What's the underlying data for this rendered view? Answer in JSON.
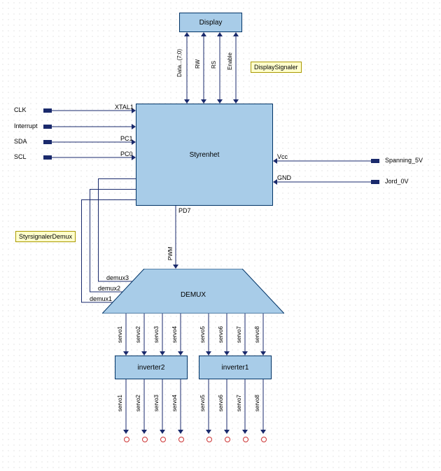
{
  "blocks": {
    "display": "Display",
    "styrenhet": "Styrenhet",
    "demux": "DEMUX",
    "inverter1": "inverter1",
    "inverter2": "inverter2"
  },
  "notes": {
    "displaySignaler": "DisplaySignaler",
    "styrsignalerDemux": "StyrsignalerDemux"
  },
  "ports": {
    "display": {
      "data": "Data...(7;0)",
      "rw": "RW",
      "rs": "RS",
      "enable": "Enable"
    },
    "styrenhet": {
      "xtal1": "XTAL1",
      "pc1": "PC1",
      "pc0": "PC0",
      "vcc": "Vcc",
      "gnd": "GND",
      "pd7": "PD7",
      "pwm": "PWM"
    },
    "demux": {
      "d1": "demux1",
      "d2": "demux2",
      "d3": "demux3"
    },
    "servo": {
      "s1": "servo1",
      "s2": "servo2",
      "s3": "servo3",
      "s4": "servo4",
      "s5": "servo5",
      "s6": "servo6",
      "s7": "servo7",
      "s8": "servo8"
    }
  },
  "external": {
    "clk": "CLK",
    "interrupt": "Interrupt",
    "sda": "SDA",
    "scl": "SCL",
    "spanning": "Spanning_5V",
    "jord": "Jord_0V"
  },
  "colors": {
    "block": "#a8cce8",
    "note": "#ffffcc",
    "wire": "#1a2a6c",
    "open": "#cc3333"
  }
}
